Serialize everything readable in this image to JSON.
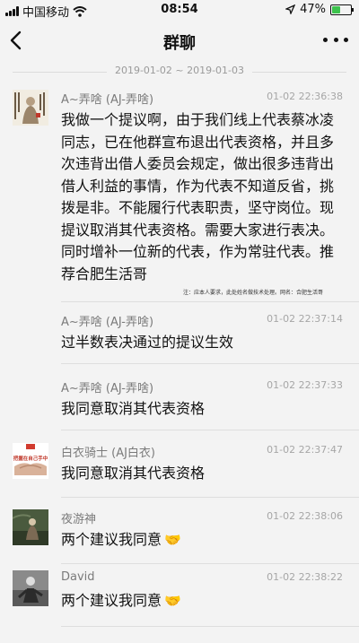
{
  "status_bar": {
    "carrier": "中国移动",
    "time": "08:54",
    "battery_text": "47%",
    "battery_level_percent": 47
  },
  "header": {
    "title": "群聊"
  },
  "date_range": "2019-01-02 ~ 2019-01-03",
  "messages": [
    {
      "sender": "A~弄啥 (AJ-弄啥)",
      "time": "01-02 22:36:38",
      "text": "我做一个提议啊，由于我们线上代表蔡冰凌同志，已在他群宣布退出代表资格，并且多次违背出借人委员会规定，做出很多违背出借人利益的事情，作为代表不知道反省，挑拨是非。不能履行代表职责，坚守岗位。现提议取消其代表资格。需要大家进行表决。同时增补一位新的代表，作为常驻代表。推荐合肥生活哥",
      "note": "注：应本人要求，此处姓名做技术处理。网名：合肥生活哥"
    },
    {
      "sender": "A~弄啥 (AJ-弄啥)",
      "time": "01-02 22:37:14",
      "text": "过半数表决通过的提议生效"
    },
    {
      "sender": "A~弄啥 (AJ-弄啥)",
      "time": "01-02 22:37:33",
      "text": "我同意取消其代表资格"
    },
    {
      "sender": "白衣骑士 (AJ白衣)",
      "time": "01-02 22:37:47",
      "text": "我同意取消其代表资格",
      "avatar_caption": "把握在自己手中"
    },
    {
      "sender": "夜游神",
      "time": "01-02 22:38:06",
      "text": "两个建议我同意",
      "emoji": "🤝"
    },
    {
      "sender": "David",
      "time": "01-02 22:38:22",
      "text": "两个建议我同意",
      "emoji": "🤝"
    }
  ],
  "colors": {
    "background": "#f3f3f3",
    "meta_text": "#7b7b7b",
    "battery_fill": "#3cc24c"
  }
}
